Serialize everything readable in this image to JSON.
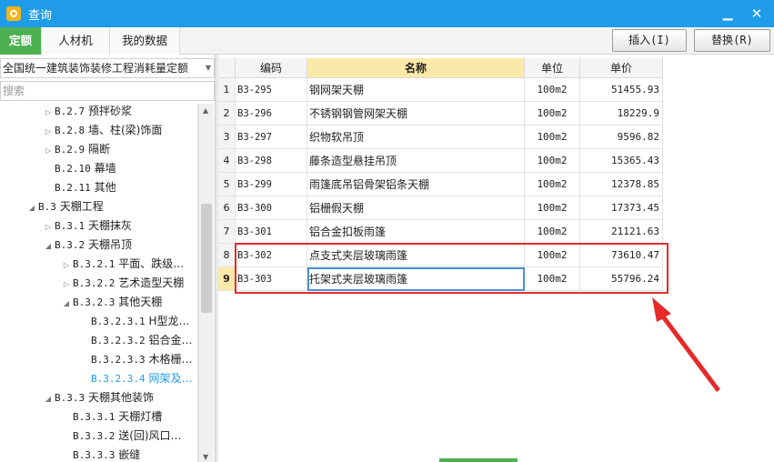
{
  "window": {
    "title": "查询",
    "minimize_icon": "minimize-icon",
    "close_icon": "close-icon"
  },
  "tabs": [
    {
      "label": "定额",
      "active": true
    },
    {
      "label": "人材机",
      "active": false
    },
    {
      "label": "我的数据",
      "active": false
    }
  ],
  "toolbar": {
    "insert_label": "插入(I)",
    "replace_label": "替换(R)"
  },
  "library": {
    "selected": "全国统一建筑装饰装修工程消耗量定额"
  },
  "search": {
    "placeholder": "搜索",
    "value": ""
  },
  "tree": [
    {
      "code": "B.2.7",
      "label": "预拌砂浆",
      "level": 2,
      "state": "collapsed"
    },
    {
      "code": "B.2.8",
      "label": "墙、柱(梁)饰面",
      "level": 2,
      "state": "collapsed"
    },
    {
      "code": "B.2.9",
      "label": "隔断",
      "level": 2,
      "state": "collapsed"
    },
    {
      "code": "B.2.10",
      "label": "幕墙",
      "level": 2,
      "state": "leaf"
    },
    {
      "code": "B.2.11",
      "label": "其他",
      "level": 2,
      "state": "leaf"
    },
    {
      "code": "B.3",
      "label": "天棚工程",
      "level": 1,
      "state": "expanded"
    },
    {
      "code": "B.3.1",
      "label": "天棚抹灰",
      "level": 2,
      "state": "collapsed"
    },
    {
      "code": "B.3.2",
      "label": "天棚吊顶",
      "level": 2,
      "state": "expanded"
    },
    {
      "code": "B.3.2.1",
      "label": "平面、跌级…",
      "level": 3,
      "state": "collapsed"
    },
    {
      "code": "B.3.2.2",
      "label": "艺术造型天棚",
      "level": 3,
      "state": "collapsed"
    },
    {
      "code": "B.3.2.3",
      "label": "其他天棚",
      "level": 3,
      "state": "expanded"
    },
    {
      "code": "B.3.2.3.1",
      "label": "H型龙…",
      "level": 4,
      "state": "leaf"
    },
    {
      "code": "B.3.2.3.2",
      "label": "铝合金…",
      "level": 4,
      "state": "leaf"
    },
    {
      "code": "B.3.2.3.3",
      "label": "木格栅…",
      "level": 4,
      "state": "leaf"
    },
    {
      "code": "B.3.2.3.4",
      "label": "网架及…",
      "level": 4,
      "state": "leaf",
      "selected": true
    },
    {
      "code": "B.3.3",
      "label": "天棚其他装饰",
      "level": 2,
      "state": "expanded"
    },
    {
      "code": "B.3.3.1",
      "label": "天棚灯槽",
      "level": 3,
      "state": "leaf"
    },
    {
      "code": "B.3.3.2",
      "label": "送(回)风口…",
      "level": 3,
      "state": "leaf"
    },
    {
      "code": "B.3.3.3",
      "label": "嵌缝",
      "level": 3,
      "state": "leaf"
    }
  ],
  "grid": {
    "columns": [
      "编码",
      "名称",
      "单位",
      "单价"
    ],
    "selected_column": "名称",
    "current_row": "9",
    "rows": [
      {
        "idx": "1",
        "code": "B3-295",
        "name": "钢网架天棚",
        "unit": "100m2",
        "price": "51455.93"
      },
      {
        "idx": "2",
        "code": "B3-296",
        "name": "不锈钢钢管网架天棚",
        "unit": "100m2",
        "price": "18229.9"
      },
      {
        "idx": "3",
        "code": "B3-297",
        "name": "织物软吊顶",
        "unit": "100m2",
        "price": "9596.82"
      },
      {
        "idx": "4",
        "code": "B3-298",
        "name": "藤条造型悬挂吊顶",
        "unit": "100m2",
        "price": "15365.43"
      },
      {
        "idx": "5",
        "code": "B3-299",
        "name": "雨篷底吊铝骨架铝条天棚",
        "unit": "100m2",
        "price": "12378.85"
      },
      {
        "idx": "6",
        "code": "B3-300",
        "name": "铝栅假天棚",
        "unit": "100m2",
        "price": "17373.45"
      },
      {
        "idx": "7",
        "code": "B3-301",
        "name": "铝合金扣板雨篷",
        "unit": "100m2",
        "price": "21121.63"
      },
      {
        "idx": "8",
        "code": "B3-302",
        "name": "点支式夹层玻璃雨篷",
        "unit": "100m2",
        "price": "73610.47"
      },
      {
        "idx": "9",
        "code": "B3-303",
        "name": "托架式夹层玻璃雨篷",
        "unit": "100m2",
        "price": "55796.24"
      }
    ]
  },
  "annotation": {
    "box_color": "#e62a2a"
  },
  "colors": {
    "title_bar": "#1e9be9",
    "active_tab": "#4cb050",
    "selected_header": "#fbe9a9",
    "tree_selected": "#1e9be9"
  }
}
